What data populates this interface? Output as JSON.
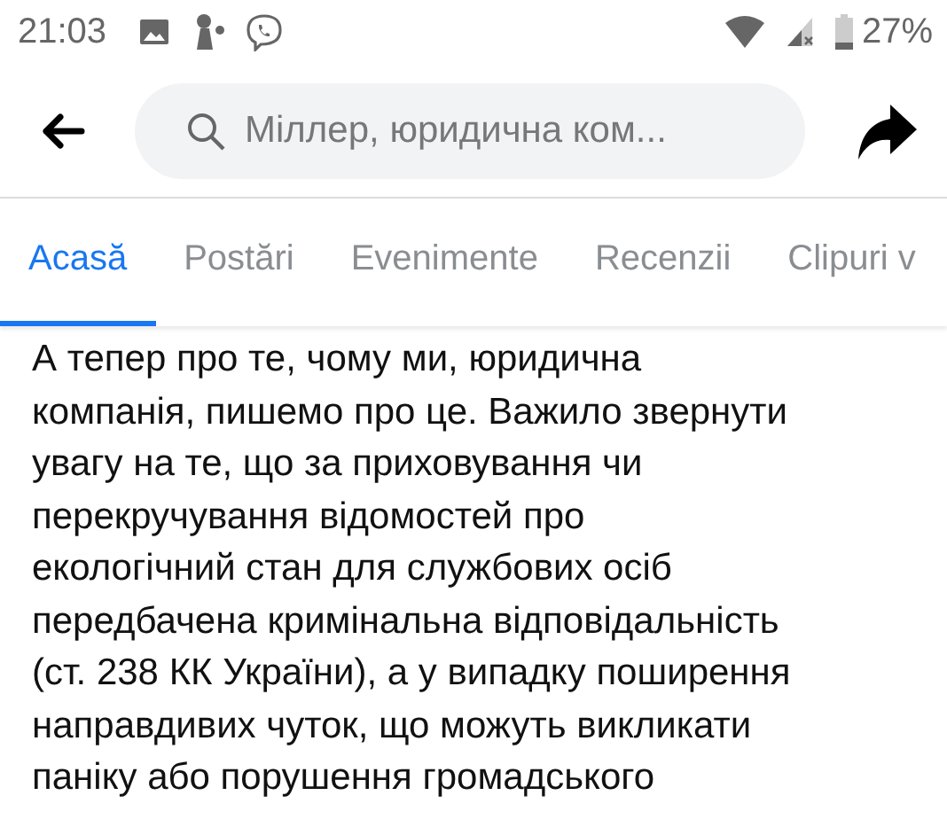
{
  "status_bar": {
    "time": "21:03",
    "battery": "27%"
  },
  "search": {
    "value": "Міллер, юридична ком..."
  },
  "tabs": [
    {
      "label": "Acasă",
      "selected": true
    },
    {
      "label": "Postări",
      "selected": false
    },
    {
      "label": "Evenimente",
      "selected": false
    },
    {
      "label": "Recenzii",
      "selected": false
    },
    {
      "label": "Clipuri v",
      "selected": false
    }
  ],
  "post": {
    "lines": [
      "А тепер про те, чому ми, юридична",
      "компанія, пишемо про це. Важило звернути",
      "увагу на те, що за приховування чи",
      "перекручування відомостей про",
      "екологічний стан для службових осіб",
      "передбачена кримінальна відповідальність",
      "(ст. 238 КК України), а у випадку поширення",
      "направдивих чуток, що можуть викликати",
      "паніку або порушення громадського"
    ]
  }
}
